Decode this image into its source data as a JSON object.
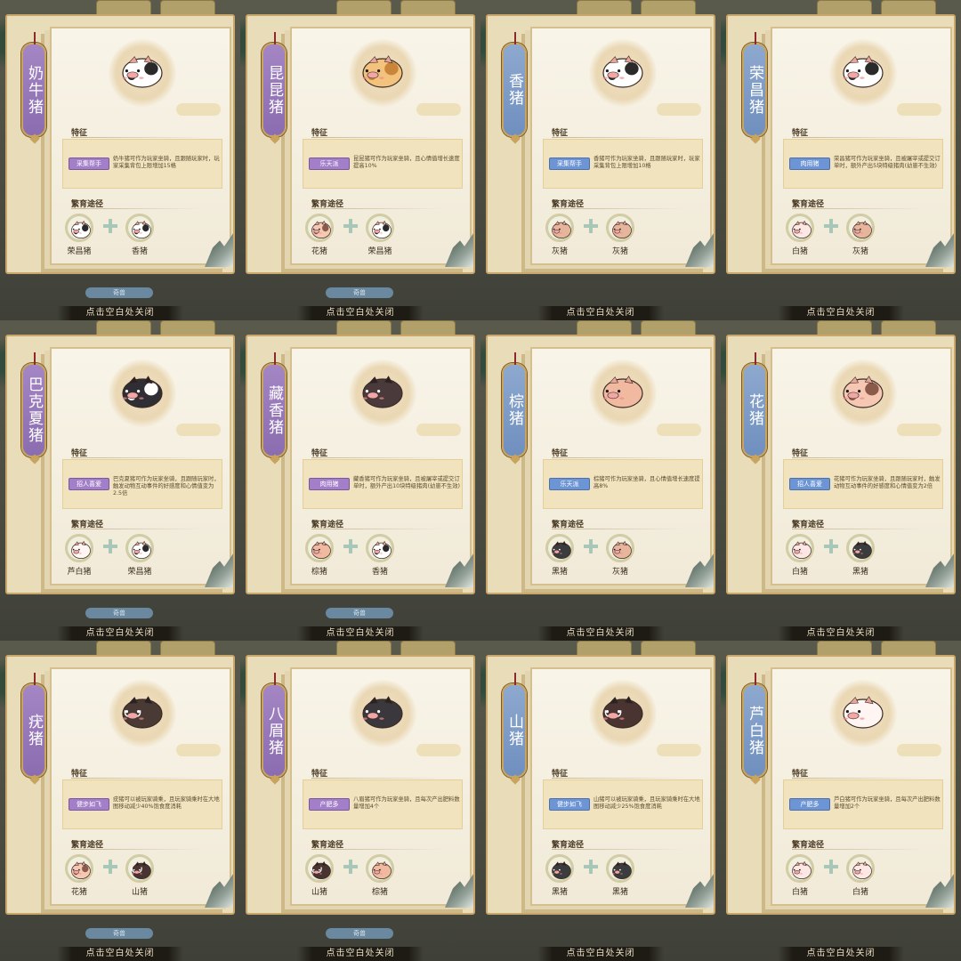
{
  "close_hint": "点击空白处关闭",
  "bottom_tab": "奇兽",
  "feature_label": "特征",
  "breed_label": "繁育途径",
  "cards": [
    {
      "name": "奶牛猪",
      "tag_color": "purple",
      "badge": "采集帮手",
      "badge_color": "purple",
      "desc": "奶牛猪可作为玩家坐骑，且跟随玩家时，玩家采集背包上限增加15格",
      "parent1": "荣昌猪",
      "parent2": "香猪",
      "pig": "cow",
      "p1": "rongchang",
      "p2": "xiang",
      "show_tab": true
    },
    {
      "name": "昆昆猪",
      "tag_color": "purple",
      "badge": "乐天派",
      "badge_color": "purple",
      "desc": "昆昆猪可作为玩家坐骑，且心情值增长速度提高10%",
      "parent1": "花猪",
      "parent2": "荣昌猪",
      "pig": "kunkun",
      "p1": "hua",
      "p2": "rongchang",
      "show_tab": true
    },
    {
      "name": "香猪",
      "tag_color": "blue",
      "badge": "采集帮手",
      "badge_color": "blue",
      "desc": "香猪可作为玩家坐骑，且跟随玩家时，玩家采集背包上限增加10格",
      "parent1": "灰猪",
      "parent2": "灰猪",
      "pig": "xiang",
      "p1": "hui",
      "p2": "hui",
      "show_tab": false
    },
    {
      "name": "荣昌猪",
      "tag_color": "blue",
      "badge": "肉用猪",
      "badge_color": "blue",
      "desc": "荣昌猪可作为玩家坐骑，且被屠宰或提交订单时，额外产出5块特级猪肉(幼崽不生效)",
      "parent1": "白猪",
      "parent2": "灰猪",
      "pig": "rongchang",
      "p1": "bai",
      "p2": "hui",
      "show_tab": false
    },
    {
      "name": "巴克夏猪",
      "tag_color": "purple",
      "badge": "招人喜爱",
      "badge_color": "purple",
      "desc": "巴克夏猪可作为玩家坐骑，且跟随玩家时，触发动物互动事件的好感度和心情值变为2.5倍",
      "parent1": "芦白猪",
      "parent2": "荣昌猪",
      "pig": "berkshire",
      "p1": "lubai",
      "p2": "rongchang",
      "show_tab": true
    },
    {
      "name": "藏香猪",
      "tag_color": "purple",
      "badge": "肉用猪",
      "badge_color": "purple",
      "desc": "藏香猪可作为玩家坐骑，且被屠宰或提交订单时，额外产出10块特级猪肉(幼崽不生效)",
      "parent1": "棕猪",
      "parent2": "香猪",
      "pig": "zangxiang",
      "p1": "zong",
      "p2": "xiang",
      "show_tab": true
    },
    {
      "name": "棕猪",
      "tag_color": "blue",
      "badge": "乐天派",
      "badge_color": "blue",
      "desc": "棕猪可作为玩家坐骑，且心情值增长速度提高8%",
      "parent1": "黑猪",
      "parent2": "灰猪",
      "pig": "zong",
      "p1": "hei",
      "p2": "hui",
      "show_tab": false
    },
    {
      "name": "花猪",
      "tag_color": "blue",
      "badge": "招人喜爱",
      "badge_color": "blue",
      "desc": "花猪可作为玩家坐骑，且跟随玩家时，触发动物互动事件的好感度和心情值变为2倍",
      "parent1": "白猪",
      "parent2": "黑猪",
      "pig": "hua",
      "p1": "bai",
      "p2": "hei",
      "show_tab": false
    },
    {
      "name": "疣猪",
      "tag_color": "purple",
      "badge": "健步如飞",
      "badge_color": "purple",
      "desc": "疣猪可以被玩家骑乘，且玩家骑乘时在大地图移动减少40%饱食度消耗",
      "parent1": "花猪",
      "parent2": "山猪",
      "pig": "warthog",
      "p1": "hua",
      "p2": "shan",
      "show_tab": true
    },
    {
      "name": "八眉猪",
      "tag_color": "purple",
      "badge": "产肥多",
      "badge_color": "purple",
      "desc": "八眉猪可作为玩家坐骑，且每次产出肥料数量增加4个",
      "parent1": "山猪",
      "parent2": "棕猪",
      "pig": "bamei",
      "p1": "shan",
      "p2": "zong",
      "show_tab": true
    },
    {
      "name": "山猪",
      "tag_color": "blue",
      "badge": "健步如飞",
      "badge_color": "blue",
      "desc": "山猪可以被玩家骑乘，且玩家骑乘时在大地图移动减少25%饱食度消耗",
      "parent1": "黑猪",
      "parent2": "黑猪",
      "pig": "shan",
      "p1": "hei",
      "p2": "hei",
      "show_tab": false
    },
    {
      "name": "芦白猪",
      "tag_color": "blue",
      "badge": "产肥多",
      "badge_color": "blue",
      "desc": "芦白猪可作为玩家坐骑，且每次产出肥料数量增加2个",
      "parent1": "白猪",
      "parent2": "白猪",
      "pig": "lubai",
      "p1": "bai",
      "p2": "bai",
      "show_tab": false
    }
  ],
  "pig_colors": {
    "cow": "#ffffff",
    "kunkun": "#f3c27c",
    "xiang": "#ffffff",
    "rongchang": "#ffffff",
    "berkshire": "#2e2e34",
    "zangxiang": "#4a3a3c",
    "zong": "#f0b9a0",
    "hua": "#f6c8b4",
    "warthog": "#4a3a36",
    "bamei": "#3a383c",
    "shan": "#4a3432",
    "lubai": "#fff5f2",
    "hui": "#e7b49c",
    "bai": "#fde7e4",
    "hei": "#3b3c3e"
  }
}
